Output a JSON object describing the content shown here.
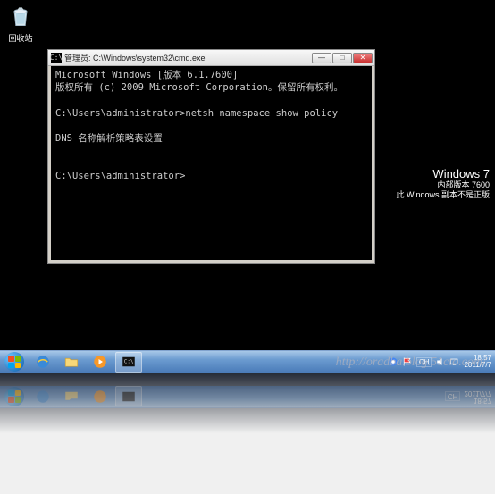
{
  "desktop": {
    "recycle_bin_label": "回收站"
  },
  "cmd": {
    "title_prefix": "管理员: ",
    "title_path": "C:\\Windows\\system32\\cmd.exe",
    "lines": {
      "l1": "Microsoft Windows [版本 6.1.7600]",
      "l2": "版权所有 (c) 2009 Microsoft Corporation。保留所有权利。",
      "l3_prompt": "C:\\Users\\administrator>",
      "l3_cmd": "netsh namespace show policy",
      "l4": "DNS 名称解析策略表设置",
      "l5_prompt": "C:\\Users\\administrator>"
    }
  },
  "branding": {
    "os": "Windows 7",
    "build": "内部版本 7600",
    "legal": "此 Windows 副本不是正版"
  },
  "taskbar": {
    "lang": "CH",
    "time": "18:57",
    "date": "2011/7/7"
  },
  "watermark": "http://oradba.blog.51cto.com/",
  "icons": {
    "min": "—",
    "max": "□",
    "close": "✕"
  }
}
